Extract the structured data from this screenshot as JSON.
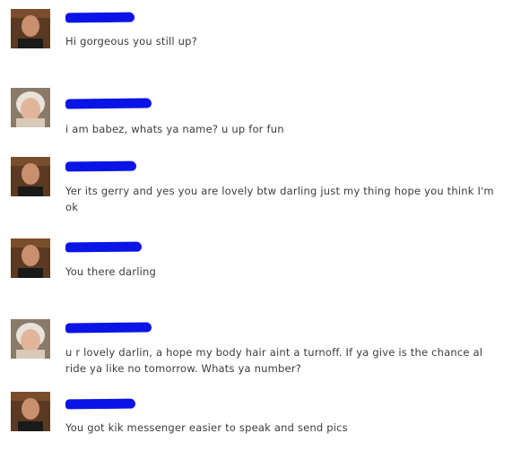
{
  "colors": {
    "redaction": "#0a14e6",
    "text": "#3b3b3b",
    "background": "#ffffff"
  },
  "messages": [
    {
      "sender": "man",
      "avatar": "man-avatar",
      "text": "Hi gorgeous you still up?"
    },
    {
      "sender": "woman",
      "avatar": "woman-avatar",
      "text": "i am babez, whats ya name? u up for fun"
    },
    {
      "sender": "man",
      "avatar": "man-avatar",
      "text": "Yer its gerry and yes you are lovely btw darling just my thing hope you think I'm ok"
    },
    {
      "sender": "man",
      "avatar": "man-avatar",
      "text": "You there darling"
    },
    {
      "sender": "woman",
      "avatar": "woman-avatar",
      "text": "u r lovely darlin, a hope my body hair aint a turnoff. If ya give is the chance al ride ya like no tomorrow. Whats ya number?"
    },
    {
      "sender": "man",
      "avatar": "man-avatar",
      "text": "You got kik messenger easier to speak and send pics"
    }
  ]
}
